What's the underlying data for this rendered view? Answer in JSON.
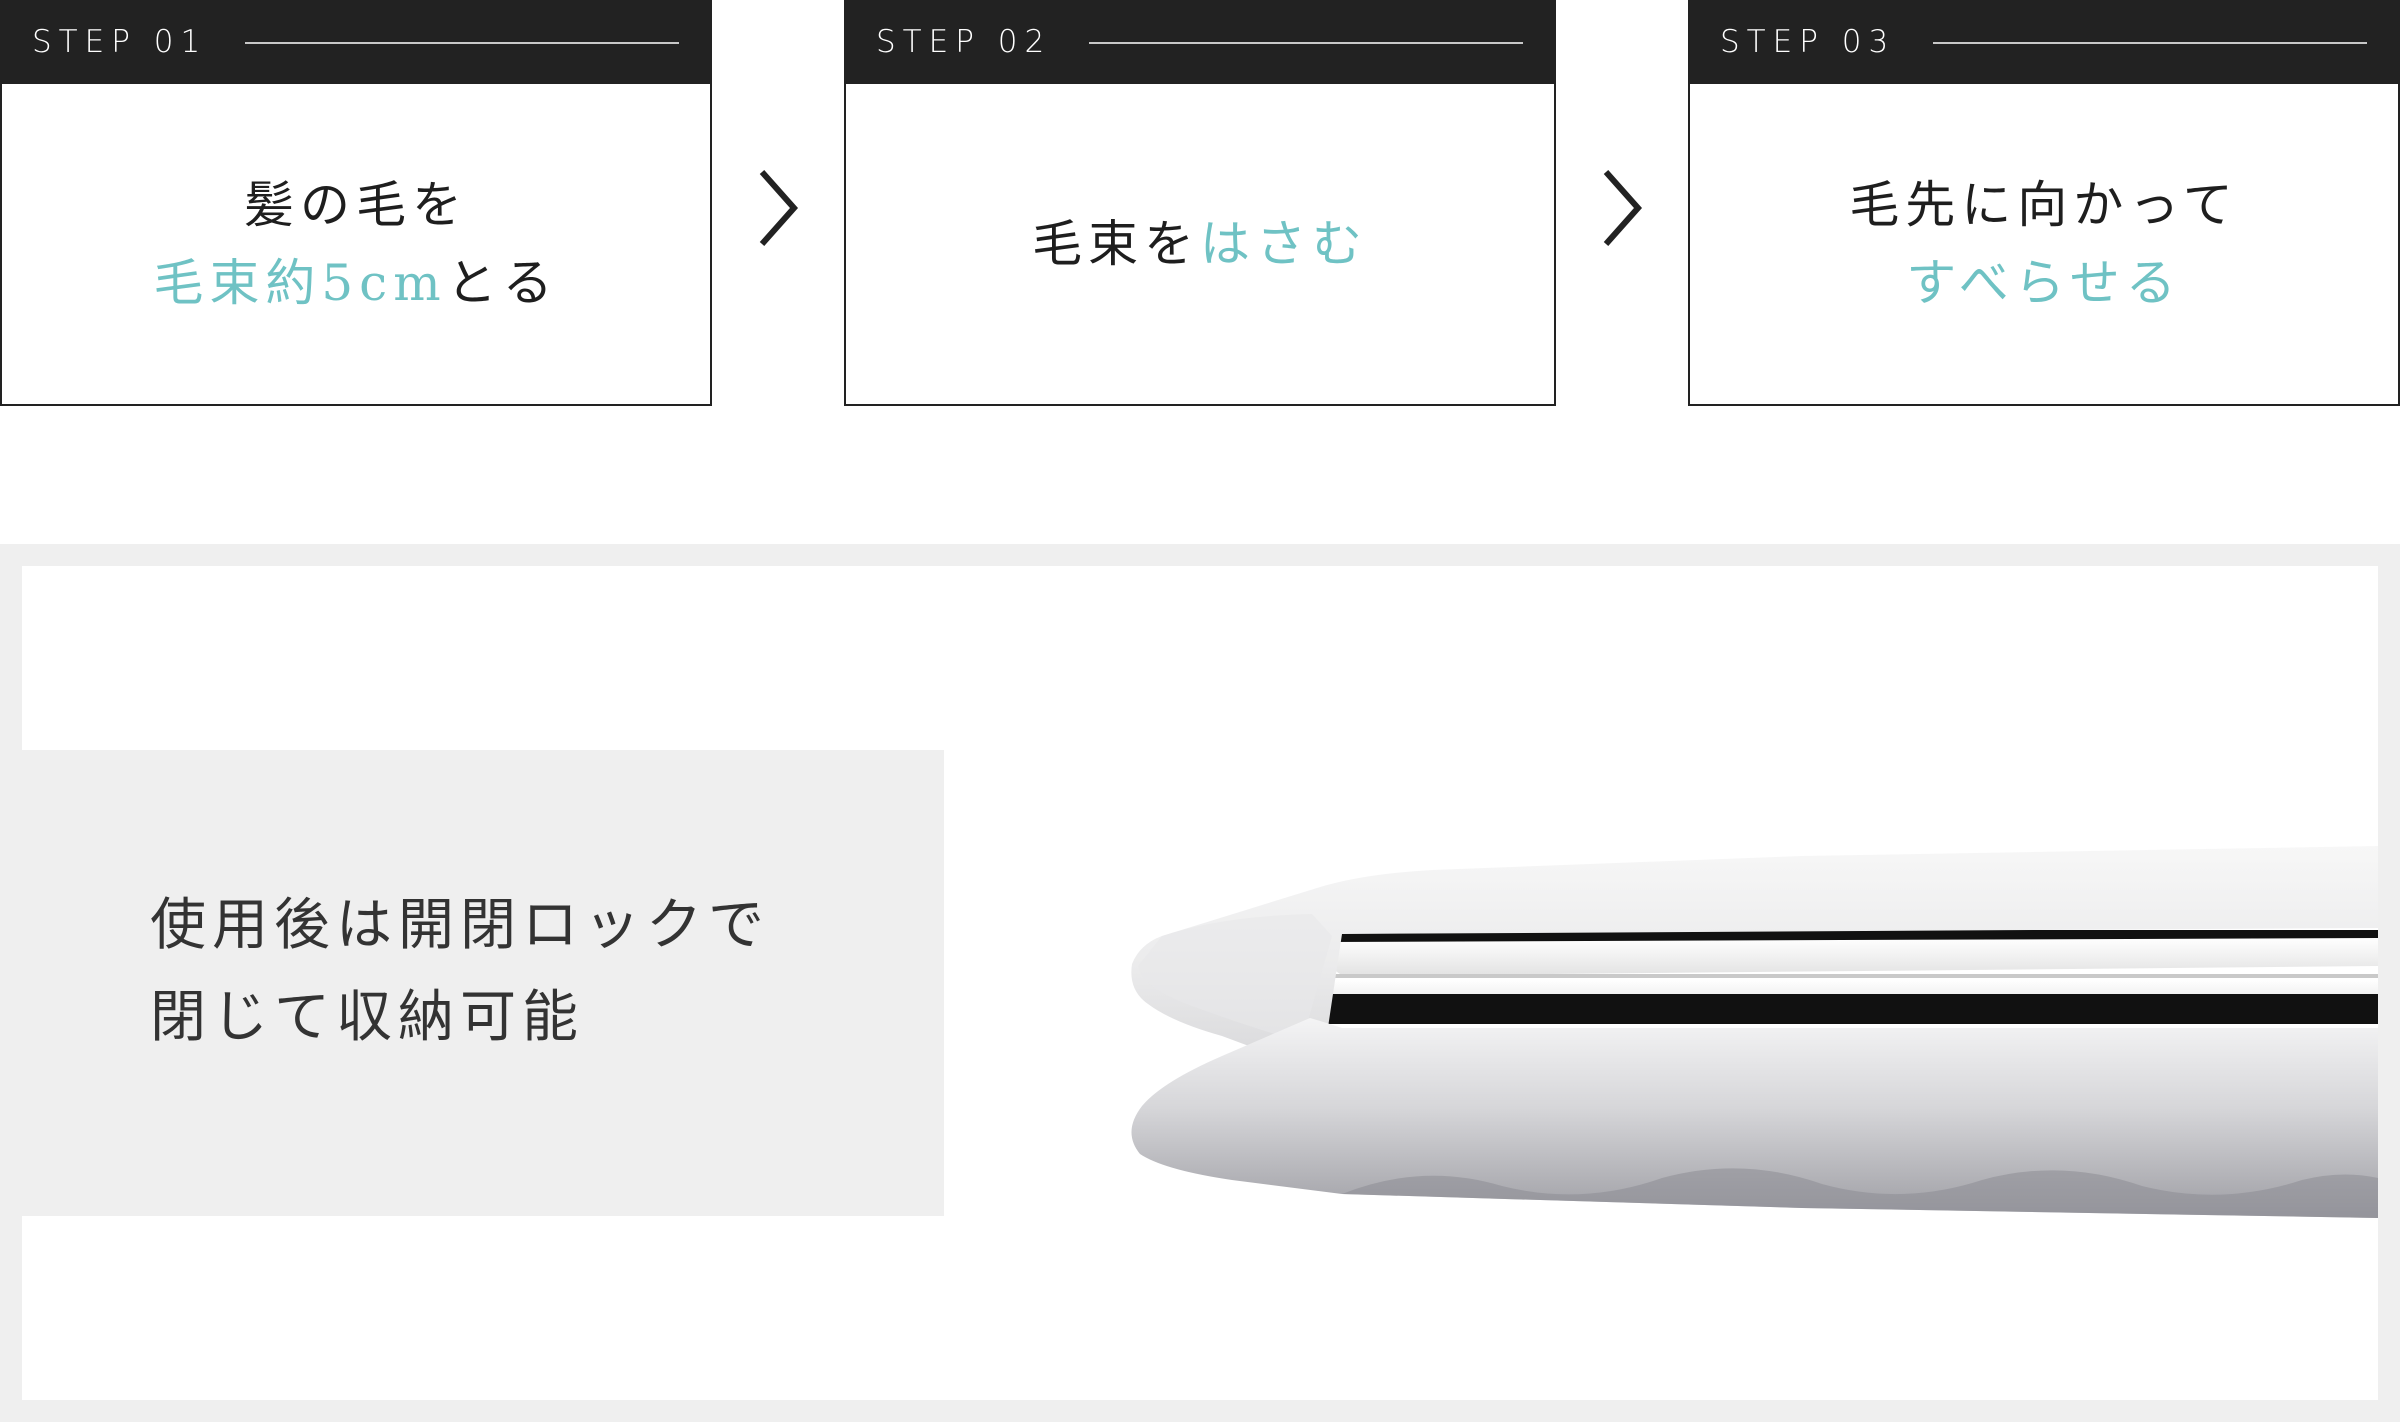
{
  "steps": [
    {
      "label": "STEP 01",
      "line1": "髪の毛を",
      "line2_accent": "毛束約5cm",
      "line2_rest": "とる"
    },
    {
      "label": "STEP 02",
      "line1_plain": "毛束を",
      "line1_accent": "はさむ"
    },
    {
      "label": "STEP 03",
      "line1": "毛先に向かって",
      "line2_accent": "すべらせる"
    }
  ],
  "product": {
    "note_line1": "使用後は開閉ロックで",
    "note_line2": "閉じて収納可能",
    "image_icon": "hair-straightener-image"
  },
  "colors": {
    "accent": "#6fc2c4",
    "header_bg": "#222222",
    "section_bg": "#efefef"
  }
}
